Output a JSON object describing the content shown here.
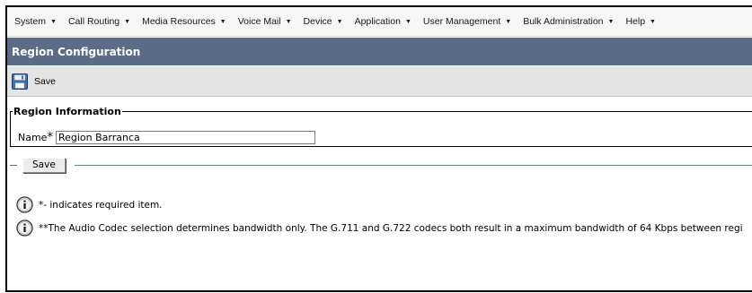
{
  "menu": [
    {
      "label": "System"
    },
    {
      "label": "Call Routing"
    },
    {
      "label": "Media Resources"
    },
    {
      "label": "Voice Mail"
    },
    {
      "label": "Device"
    },
    {
      "label": "Application"
    },
    {
      "label": "User Management"
    },
    {
      "label": "Bulk Administration"
    },
    {
      "label": "Help"
    }
  ],
  "page": {
    "title": "Region Configuration"
  },
  "toolbar": {
    "save_label": "Save",
    "icon": "floppy-disk-icon"
  },
  "region_info": {
    "legend": "Region Information",
    "name_label": "Name",
    "required_marker": "*",
    "name_value": "Region Barranca"
  },
  "bottom": {
    "save_button": "Save"
  },
  "notes": [
    "*- indicates required item.",
    "**The Audio Codec selection determines bandwidth only. The G.711 and G.722 codecs both result in a maximum bandwidth of 64 Kbps between regi"
  ],
  "colors": {
    "title_bar": "#5b6c87",
    "toolbar_bg": "#e4e4e4",
    "menu_bg": "#f6f6f6",
    "rule": "#5d8c86"
  }
}
